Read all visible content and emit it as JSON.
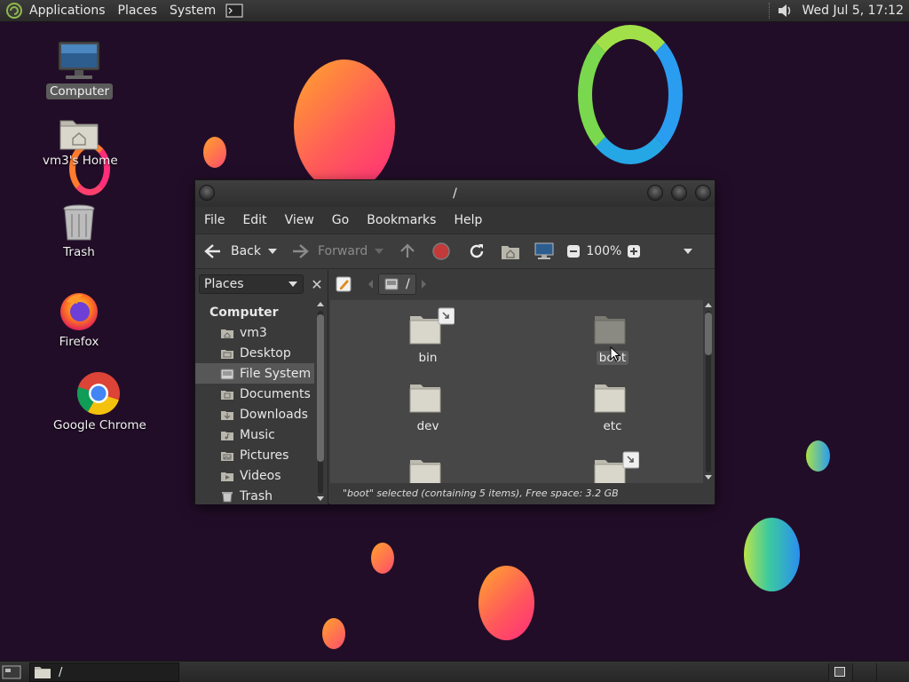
{
  "top_panel": {
    "menus": [
      "Applications",
      "Places",
      "System"
    ],
    "clock": "Wed Jul 5, 17:12",
    "icons": [
      "mate-logo-icon",
      "terminal-icon",
      "volume-icon"
    ]
  },
  "desktop_icons": [
    {
      "label": "Computer",
      "icon": "computer-icon",
      "selected": true
    },
    {
      "label": "vm3's Home",
      "icon": "home-folder-icon",
      "selected": false
    },
    {
      "label": "Trash",
      "icon": "trash-icon",
      "selected": false
    },
    {
      "label": "Firefox",
      "icon": "firefox-icon",
      "selected": false
    },
    {
      "label": "Google Chrome",
      "icon": "chrome-icon",
      "selected": false
    }
  ],
  "window": {
    "title": "/",
    "menus": [
      "File",
      "Edit",
      "View",
      "Go",
      "Bookmarks",
      "Help"
    ],
    "toolbar": {
      "back": "Back",
      "forward": "Forward",
      "zoom": "100%",
      "icons": [
        "back-arrow-icon",
        "forward-arrow-icon",
        "up-icon",
        "stop-icon",
        "reload-icon",
        "home-icon",
        "computer-icon",
        "zoom-out-icon",
        "zoom-in-icon"
      ]
    },
    "sidebar": {
      "combo_label": "Places",
      "category": "Computer",
      "items": [
        {
          "label": "vm3",
          "icon": "home-icon",
          "selected": false
        },
        {
          "label": "Desktop",
          "icon": "desktop-icon",
          "selected": false
        },
        {
          "label": "File System",
          "icon": "drive-icon",
          "selected": true
        },
        {
          "label": "Documents",
          "icon": "documents-icon",
          "selected": false
        },
        {
          "label": "Downloads",
          "icon": "downloads-icon",
          "selected": false
        },
        {
          "label": "Music",
          "icon": "music-icon",
          "selected": false
        },
        {
          "label": "Pictures",
          "icon": "pictures-icon",
          "selected": false
        },
        {
          "label": "Videos",
          "icon": "videos-icon",
          "selected": false
        },
        {
          "label": "Trash",
          "icon": "trash-icon",
          "selected": false
        }
      ]
    },
    "path_crumb": "/",
    "files": [
      {
        "label": "bin",
        "symlink": true,
        "selected": false
      },
      {
        "label": "boot",
        "symlink": false,
        "selected": true
      },
      {
        "label": "dev",
        "symlink": false,
        "selected": false
      },
      {
        "label": "etc",
        "symlink": false,
        "selected": false
      },
      {
        "label": "",
        "symlink": false,
        "selected": false
      },
      {
        "label": "",
        "symlink": true,
        "selected": false
      }
    ],
    "status": "\"boot\" selected (containing 5 items), Free space: 3.2 GB"
  },
  "bottom_panel": {
    "task_label": "/"
  },
  "colors": {
    "wallpaper": "#220d28",
    "panel": "#2f2f2f",
    "window_bg": "#3c3c3c",
    "folder": "#d9d7cc",
    "selection": "#575757"
  }
}
